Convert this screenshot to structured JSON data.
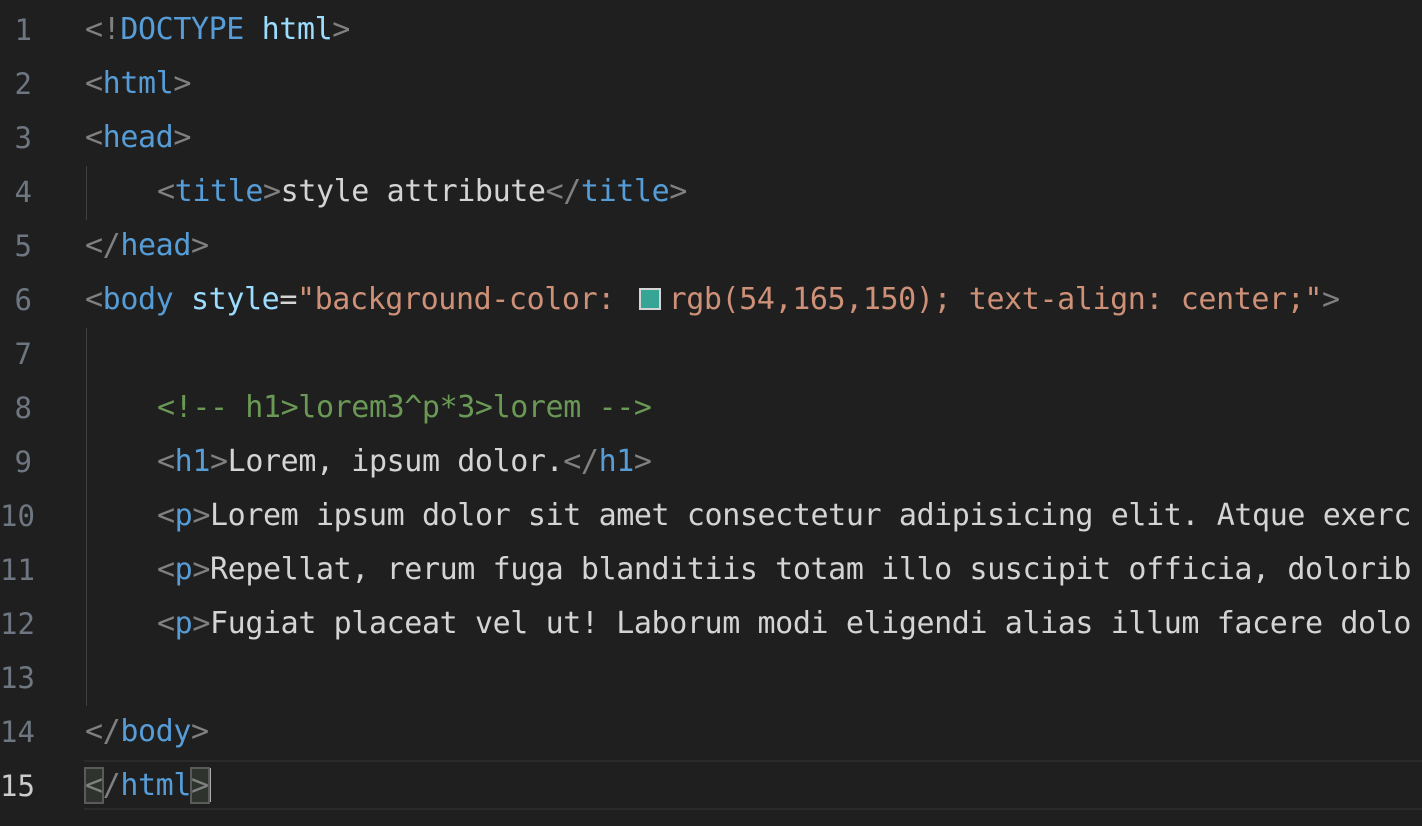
{
  "editor": {
    "active_line": "15",
    "swatch_color": "#36a596",
    "lines": [
      {
        "num": "1",
        "parts": [
          [
            "bracket",
            "<!"
          ],
          [
            "tag",
            "DOCTYPE"
          ],
          [
            "txt",
            " "
          ],
          [
            "attr",
            "html"
          ],
          [
            "bracket",
            ">"
          ]
        ]
      },
      {
        "num": "2",
        "parts": [
          [
            "bracket",
            "<"
          ],
          [
            "tag",
            "html"
          ],
          [
            "bracket",
            ">"
          ]
        ]
      },
      {
        "num": "3",
        "parts": [
          [
            "bracket",
            "<"
          ],
          [
            "tag",
            "head"
          ],
          [
            "bracket",
            ">"
          ]
        ]
      },
      {
        "num": "4",
        "parts": [
          [
            "bracket",
            "<"
          ],
          [
            "tag",
            "title"
          ],
          [
            "bracket",
            ">"
          ],
          [
            "txt",
            "style attribute"
          ],
          [
            "bracket",
            "</"
          ],
          [
            "tag",
            "title"
          ],
          [
            "bracket",
            ">"
          ]
        ]
      },
      {
        "num": "5",
        "parts": [
          [
            "bracket",
            "</"
          ],
          [
            "tag",
            "head"
          ],
          [
            "bracket",
            ">"
          ]
        ]
      },
      {
        "num": "6",
        "parts": [
          [
            "bracket",
            "<"
          ],
          [
            "tag",
            "body"
          ],
          [
            "txt",
            " "
          ],
          [
            "attr",
            "style"
          ],
          [
            "txt",
            "="
          ],
          [
            "str",
            "\"background-color: "
          ],
          [
            "swatch",
            ""
          ],
          [
            "str",
            "rgb(54,165,150); text-align: center;\""
          ],
          [
            "bracket",
            ">"
          ]
        ]
      },
      {
        "num": "7",
        "parts": []
      },
      {
        "num": "8",
        "parts": [
          [
            "cmt",
            "<!-- h1>lorem3^p*3>lorem -->"
          ]
        ]
      },
      {
        "num": "9",
        "parts": [
          [
            "bracket",
            "<"
          ],
          [
            "tag",
            "h1"
          ],
          [
            "bracket",
            ">"
          ],
          [
            "txt",
            "Lorem, ipsum dolor."
          ],
          [
            "bracket",
            "</"
          ],
          [
            "tag",
            "h1"
          ],
          [
            "bracket",
            ">"
          ]
        ]
      },
      {
        "num": "10",
        "parts": [
          [
            "bracket",
            "<"
          ],
          [
            "tag",
            "p"
          ],
          [
            "bracket",
            ">"
          ],
          [
            "txt",
            "Lorem ipsum dolor sit amet consectetur adipisicing elit. Atque exerc"
          ]
        ]
      },
      {
        "num": "11",
        "parts": [
          [
            "bracket",
            "<"
          ],
          [
            "tag",
            "p"
          ],
          [
            "bracket",
            ">"
          ],
          [
            "txt",
            "Repellat, rerum fuga blanditiis totam illo suscipit officia, dolorib"
          ]
        ]
      },
      {
        "num": "12",
        "parts": [
          [
            "bracket",
            "<"
          ],
          [
            "tag",
            "p"
          ],
          [
            "bracket",
            ">"
          ],
          [
            "txt",
            "Fugiat placeat vel ut! Laborum modi eligendi alias illum facere dolo"
          ]
        ]
      },
      {
        "num": "13",
        "parts": []
      },
      {
        "num": "14",
        "parts": [
          [
            "bracket",
            "</"
          ],
          [
            "tag",
            "body"
          ],
          [
            "bracket",
            ">"
          ]
        ]
      },
      {
        "num": "15",
        "parts": [
          [
            "match",
            "<"
          ],
          [
            "bracket",
            "/"
          ],
          [
            "tag",
            "html"
          ],
          [
            "match",
            ">"
          ],
          [
            "cursor",
            ""
          ]
        ]
      }
    ]
  }
}
